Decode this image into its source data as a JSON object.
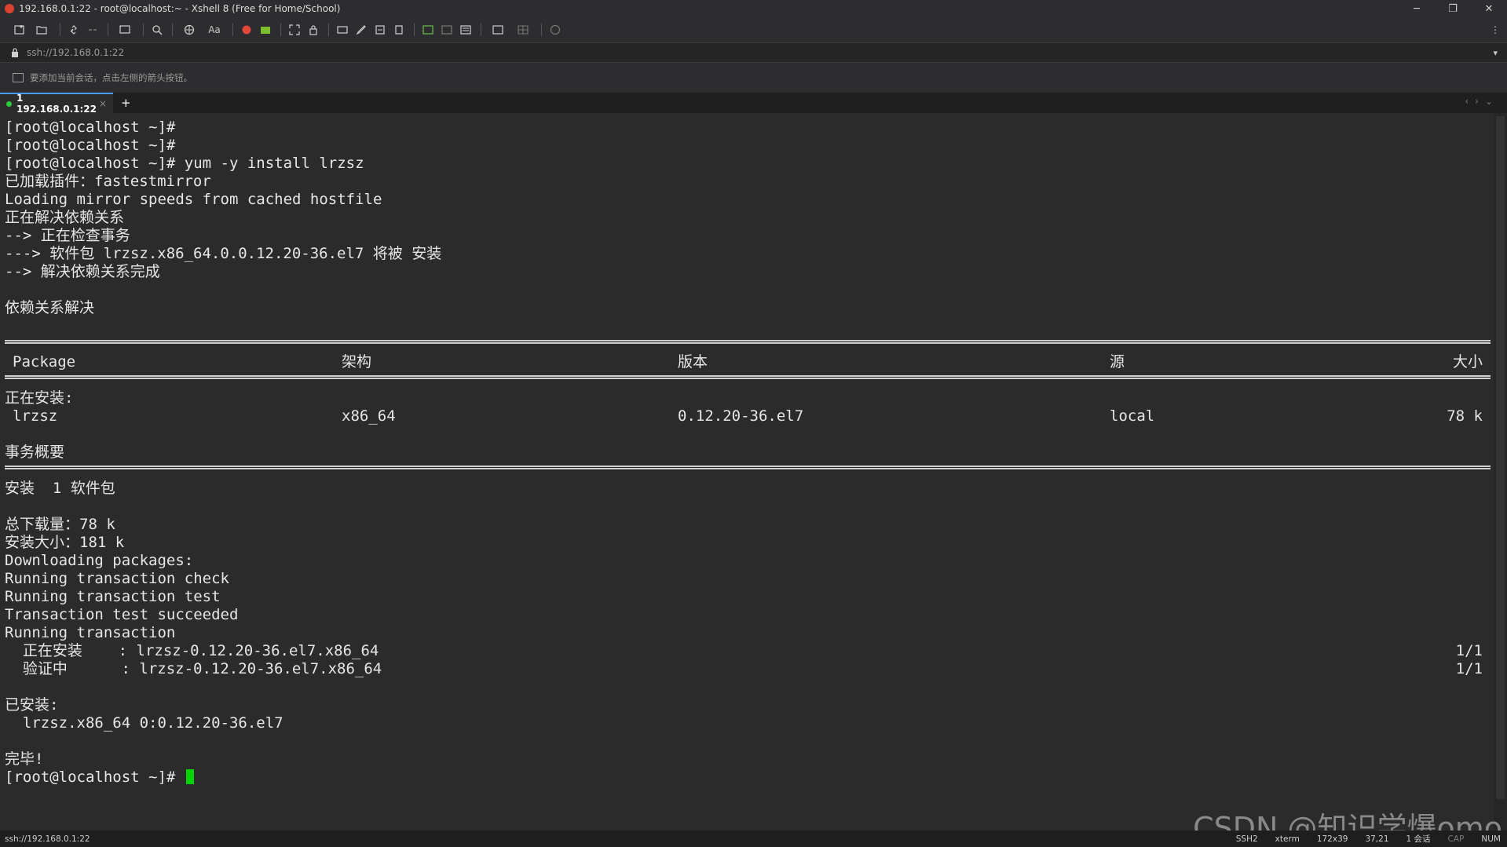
{
  "window": {
    "title": "192.168.0.1:22 - root@localhost:~ - Xshell 8 (Free for Home/School)",
    "minimize": "─",
    "maximize": "❐",
    "close": "✕"
  },
  "toolbar": {
    "font_label": "Aa"
  },
  "address": {
    "url": "ssh://192.168.0.1:22"
  },
  "hint": {
    "text": "要添加当前会话，点击左侧的箭头按钮。"
  },
  "tabs": [
    {
      "label": "1 192.168.0.1:22",
      "close": "×"
    }
  ],
  "tab_add": "+",
  "terminal": {
    "lines_top": [
      "[root@localhost ~]#",
      "[root@localhost ~]#",
      "[root@localhost ~]# yum -y install lrzsz",
      "已加载插件：fastestmirror",
      "Loading mirror speeds from cached hostfile",
      "正在解决依赖关系",
      "--> 正在检查事务",
      "---> 软件包 lrzsz.x86_64.0.0.12.20-36.el7 将被 安装",
      "--> 解决依赖关系完成",
      "",
      "依赖关系解决"
    ],
    "table_headers": {
      "package": "Package",
      "arch": "架构",
      "version": "版本",
      "repo": "源",
      "size": "大小"
    },
    "installing_label": "正在安装:",
    "table_row": {
      "package": "lrzsz",
      "arch": "x86_64",
      "version": "0.12.20-36.el7",
      "repo": "local",
      "size": "78 k"
    },
    "summary_label": "事务概要",
    "install_count": "安装  1 软件包",
    "lines_bottom": [
      "总下载量：78 k",
      "安装大小：181 k",
      "Downloading packages:",
      "Running transaction check",
      "Running transaction test",
      "Transaction test succeeded",
      "Running transaction"
    ],
    "progress_lines": [
      {
        "text": "  正在安装    : lrzsz-0.12.20-36.el7.x86_64",
        "count": "1/1"
      },
      {
        "text": "  验证中      : lrzsz-0.12.20-36.el7.x86_64",
        "count": "1/1"
      }
    ],
    "installed_label": "已安装:",
    "installed_pkg": "  lrzsz.x86_64 0:0.12.20-36.el7",
    "done": "完毕!",
    "prompt": "[root@localhost ~]# "
  },
  "status": {
    "left": "ssh://192.168.0.1:22",
    "protocol": "SSH2",
    "term": "xterm",
    "size": "172x39",
    "pos": "37,21",
    "sessions": "1 会话",
    "cap": "CAP",
    "num": "NUM"
  },
  "watermark": "CSDN @知识学爆omo"
}
